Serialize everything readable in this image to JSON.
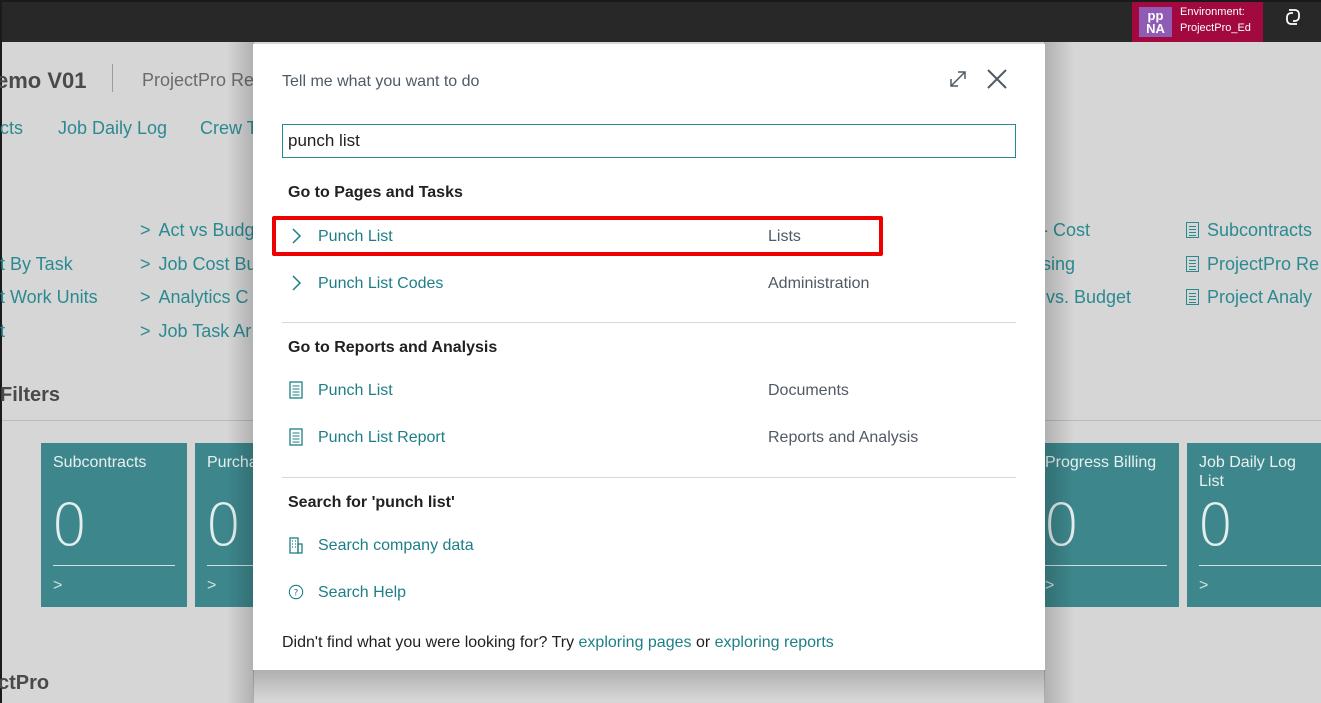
{
  "topbar": {
    "environment": {
      "avatar_line1": "pp",
      "avatar_line2": "NA",
      "label_line1": "Environment:",
      "label_line2": "ProjectPro_Ed",
      "color": "#a2093f"
    },
    "copilot_icon": "copilot-icon"
  },
  "background_page": {
    "title": "emo V01",
    "subtitle": "ProjectPro Re",
    "nav": [
      "cts",
      "Job Daily Log",
      "Crew T"
    ],
    "col1_links": [
      "t By Task",
      "t Work Units",
      "t"
    ],
    "col2_links": [
      "Act vs Budg",
      "Job Cost Bu",
      "Analytics C",
      "Job Task Ar"
    ],
    "col3_links": [
      "- Cost",
      "sing",
      "vs. Budget"
    ],
    "col4_links": [
      "Subcontracts",
      "ProjectPro Re",
      "Project Analy"
    ],
    "section_title": "Filters",
    "tiles": [
      {
        "label": "Subcontracts",
        "value": "0"
      },
      {
        "label": "Purcha",
        "value": "0"
      },
      {
        "label": "Progress Billing",
        "value": "0"
      },
      {
        "label": "Job Daily Log List",
        "value": "0"
      }
    ],
    "footer_title": "ctPro",
    "tile_color": "#3d878c",
    "link_color": "#2b8a91"
  },
  "dialog": {
    "title": "Tell me what you want to do",
    "search": {
      "value": "punch list",
      "placeholder": ""
    },
    "sections": {
      "pages": {
        "heading": "Go to Pages and Tasks",
        "items": [
          {
            "name": "Punch List",
            "category": "Lists",
            "icon": "chevron-right-icon",
            "highlighted": true
          },
          {
            "name": "Punch List Codes",
            "category": "Administration",
            "icon": "chevron-right-icon"
          }
        ]
      },
      "reports": {
        "heading": "Go to Reports and Analysis",
        "items": [
          {
            "name": "Punch List",
            "category": "Documents",
            "icon": "report-icon"
          },
          {
            "name": "Punch List Report",
            "category": "Reports and Analysis",
            "icon": "report-icon"
          }
        ]
      },
      "search": {
        "heading": "Search for 'punch list'",
        "items": [
          {
            "name": "Search company data",
            "icon": "building-icon"
          },
          {
            "name": "Search Help",
            "icon": "help-circle-icon"
          }
        ]
      }
    },
    "footer": {
      "prefix": "Didn't find what you were looking for? Try ",
      "link1": "exploring pages",
      "middle": " or ",
      "link2": "exploring reports"
    },
    "accent_color": "#1d7f86",
    "highlight_color": "#ee0000"
  }
}
